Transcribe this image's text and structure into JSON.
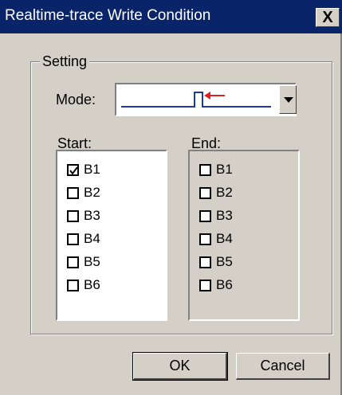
{
  "window": {
    "title": "Realtime-trace Write Condition",
    "close_glyph": "X"
  },
  "setting": {
    "group_label": "Setting",
    "mode_label": "Mode:",
    "mode_icon": "trigger-pulse-icon",
    "start_label": "Start:",
    "end_label": "End:",
    "start_items": [
      {
        "label": "B1",
        "checked": true
      },
      {
        "label": "B2",
        "checked": false
      },
      {
        "label": "B3",
        "checked": false
      },
      {
        "label": "B4",
        "checked": false
      },
      {
        "label": "B5",
        "checked": false
      },
      {
        "label": "B6",
        "checked": false
      }
    ],
    "end_items": [
      {
        "label": "B1",
        "checked": false
      },
      {
        "label": "B2",
        "checked": false
      },
      {
        "label": "B3",
        "checked": false
      },
      {
        "label": "B4",
        "checked": false
      },
      {
        "label": "B5",
        "checked": false
      },
      {
        "label": "B6",
        "checked": false
      }
    ]
  },
  "buttons": {
    "ok": "OK",
    "cancel": "Cancel"
  },
  "colors": {
    "title_bar": "#0a246a",
    "face": "#d4d0c8",
    "signal_line": "#1a3aa0",
    "marker_arrow": "#e02020"
  }
}
